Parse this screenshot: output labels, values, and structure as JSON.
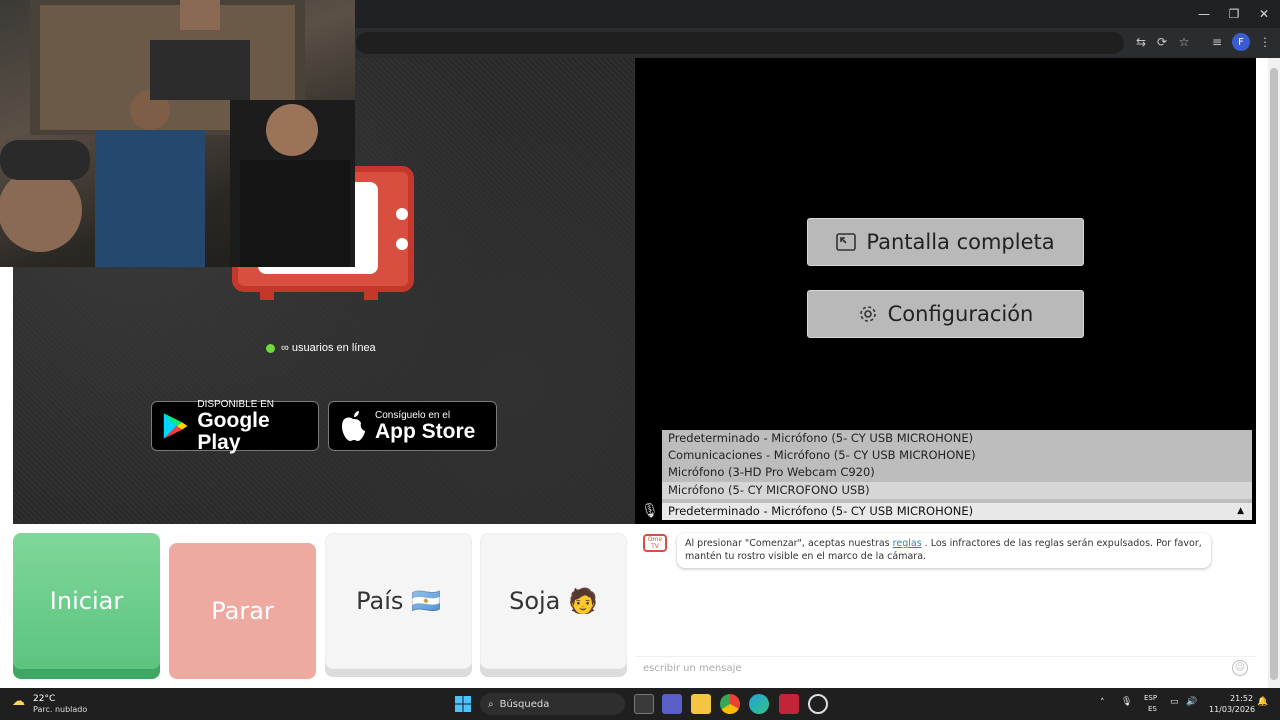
{
  "window": {
    "minimize": "—",
    "restore": "❐",
    "close": "✕"
  },
  "toolbar": {
    "translate": "⇆",
    "cast": "⟳",
    "bookmark": "☆",
    "list": "≡",
    "profile": "F",
    "menu": "⋮"
  },
  "page": {
    "online_text": "∞ usuarios en línea",
    "google_play": {
      "small": "DISPONIBLE EN",
      "big": "Google Play"
    },
    "app_store": {
      "small": "Consíguelo en el",
      "big": "App Store"
    },
    "fullscreen_label": "Pantalla completa",
    "settings_label": "Configuración"
  },
  "mic": {
    "options": [
      "Predeterminado - Micrófono (5- CY USB MICROHONE)",
      "Comunicaciones - Micrófono (5- CY USB MICROHONE)",
      "Micrófono (3-HD Pro Webcam C920)",
      "Micrófono (5- CY MICROFONO USB)"
    ],
    "selected": "Predeterminado - Micrófono (5- CY USB MICROHONE)",
    "caret": "▲"
  },
  "actions": {
    "start": "Iniciar",
    "stop": "Parar",
    "country": "País 🇦🇷",
    "gender": "Soja 🧑"
  },
  "chat": {
    "avatar": "Ome TV",
    "message_before": "Al presionar \"Comenzar\", aceptas nuestras ",
    "message_link": "reglas",
    "message_after": " . Los infractores de las reglas serán expulsados. Por favor, mantén tu rostro visible en el marco de la cámara.",
    "input_placeholder": "escribir un mensaje"
  },
  "taskbar": {
    "temperature": "22°C",
    "weather": "Parc. nublado",
    "search": "Búsqueda",
    "lang_top": "ESP",
    "lang_bottom": "ES",
    "time": "21:52",
    "date": "11/03/2026"
  },
  "colors": {
    "brand_red": "#d94f3f",
    "start_green": "#5cc47f",
    "stop_pink": "#eeaaa0"
  }
}
